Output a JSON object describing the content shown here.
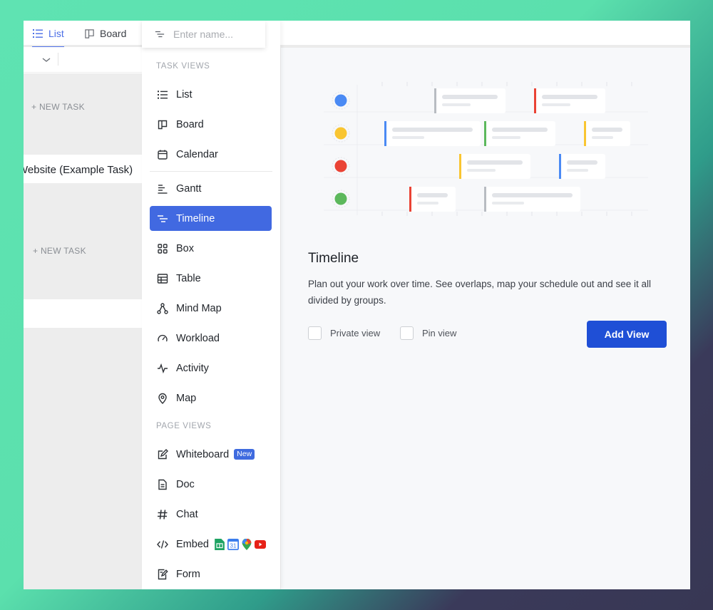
{
  "tabs": {
    "list": "List",
    "board": "Board"
  },
  "background": {
    "new_task_1": "+ NEW TASK",
    "new_task_2": "+ NEW TASK",
    "task_name": "Website (Example Task)"
  },
  "menu": {
    "search_placeholder": "Enter name...",
    "task_views_label": "TASK VIEWS",
    "page_views_label": "PAGE VIEWS",
    "items": {
      "list": "List",
      "board": "Board",
      "calendar": "Calendar",
      "gantt": "Gantt",
      "timeline": "Timeline",
      "box": "Box",
      "table": "Table",
      "mind_map": "Mind Map",
      "workload": "Workload",
      "activity": "Activity",
      "map": "Map",
      "whiteboard": "Whiteboard",
      "doc": "Doc",
      "chat": "Chat",
      "embed": "Embed",
      "form": "Form"
    },
    "whiteboard_badge": "New",
    "calendar_icon_day": "31",
    "active_item": "Timeline"
  },
  "preview": {
    "title": "Timeline",
    "description": "Plan out your work over time. See overlaps, map your schedule out and see it all divided by groups.",
    "private_view_label": "Private view",
    "pin_view_label": "Pin view",
    "add_view_label": "Add View"
  },
  "colors": {
    "accent": "#4169e1",
    "add_button": "#1f4fd6",
    "dot_blue": "#4a8af4",
    "dot_yellow": "#f9c531",
    "dot_red": "#ea4335",
    "dot_green": "#5cb85c"
  }
}
